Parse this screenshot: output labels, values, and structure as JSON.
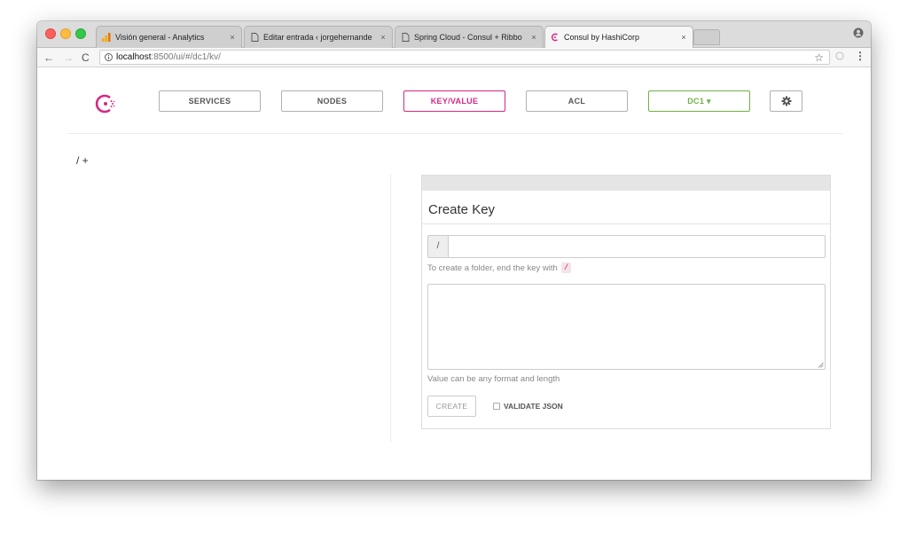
{
  "browser": {
    "tabs": [
      {
        "title": "Visión general - Analytics",
        "icon": "analytics-icon",
        "close": "×"
      },
      {
        "title": "Editar entrada ‹ jorgehernande",
        "icon": "page-icon",
        "close": "×"
      },
      {
        "title": "Spring Cloud - Consul + Ribbo",
        "icon": "page-icon",
        "close": "×"
      },
      {
        "title": "Consul by HashiCorp",
        "icon": "consul-icon",
        "close": "×"
      }
    ],
    "nav": {
      "back": "←",
      "forward": "→",
      "reload": "C"
    },
    "url": {
      "host": "localhost",
      "path": ":8500/ui/#/dc1/kv/"
    },
    "star": "☆",
    "menu": "⋮"
  },
  "consul": {
    "nav": {
      "services": "SERVICES",
      "nodes": "NODES",
      "kv": "KEY/VALUE",
      "acl": "ACL",
      "dc": "DC1 ▾"
    },
    "accent_colors": {
      "kv": "#d62783",
      "dc": "#70b046"
    },
    "breadcrumb": "/ +",
    "create_key": {
      "title": "Create Key",
      "prefix": "/",
      "key_value": "",
      "folder_help": "To create a folder, end the key with",
      "folder_code": "/",
      "value_help": "Value can be any format and length",
      "create_label": "CREATE",
      "validate_label": "VALIDATE JSON",
      "validate_checked": false
    }
  }
}
